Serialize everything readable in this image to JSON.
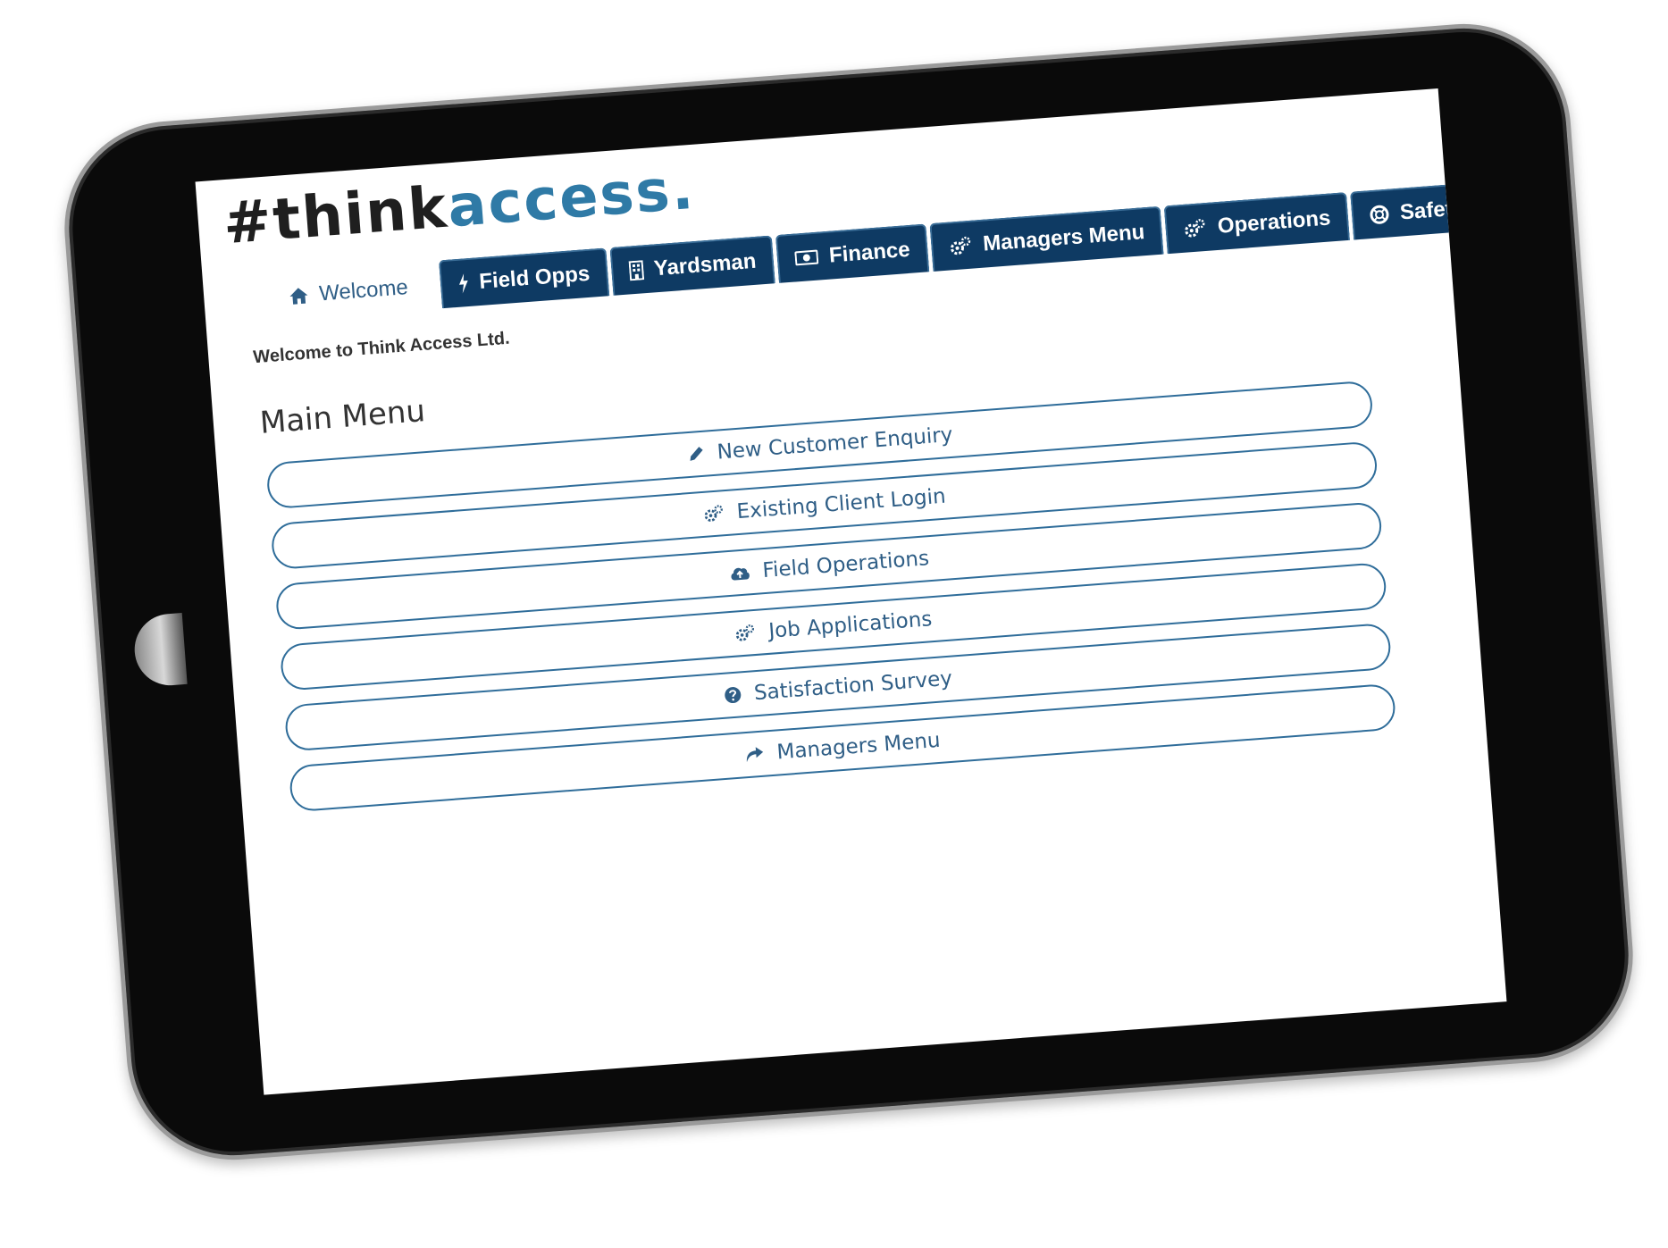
{
  "logo": {
    "part1": "#think",
    "part2": "access."
  },
  "nav": {
    "tabs": [
      {
        "label": "Welcome",
        "icon": "home-icon"
      },
      {
        "label": "Field Opps",
        "icon": "bolt-icon"
      },
      {
        "label": "Yardsman",
        "icon": "building-icon"
      },
      {
        "label": "Finance",
        "icon": "money-icon"
      },
      {
        "label": "Managers Menu",
        "icon": "cogs-icon"
      },
      {
        "label": "Operations",
        "icon": "cogs-icon"
      },
      {
        "label": "Safety",
        "icon": "life-ring-icon"
      }
    ]
  },
  "welcome_message": "Welcome to Think Access Ltd.",
  "main_menu": {
    "title": "Main Menu",
    "items": [
      {
        "label": "New Customer Enquiry",
        "icon": "pencil-icon"
      },
      {
        "label": "Existing Client Login",
        "icon": "cogs-icon"
      },
      {
        "label": "Field Operations",
        "icon": "cloud-upload-icon"
      },
      {
        "label": "Job Applications",
        "icon": "cogs-icon"
      },
      {
        "label": "Satisfaction Survey",
        "icon": "question-circle-icon"
      },
      {
        "label": "Managers Menu",
        "icon": "share-arrow-icon"
      }
    ]
  },
  "colors": {
    "nav_background": "#0e3a63",
    "accent_blue": "#2f7aa6",
    "menu_border": "#2f6d9a",
    "device_body": "#0a0a0a"
  }
}
